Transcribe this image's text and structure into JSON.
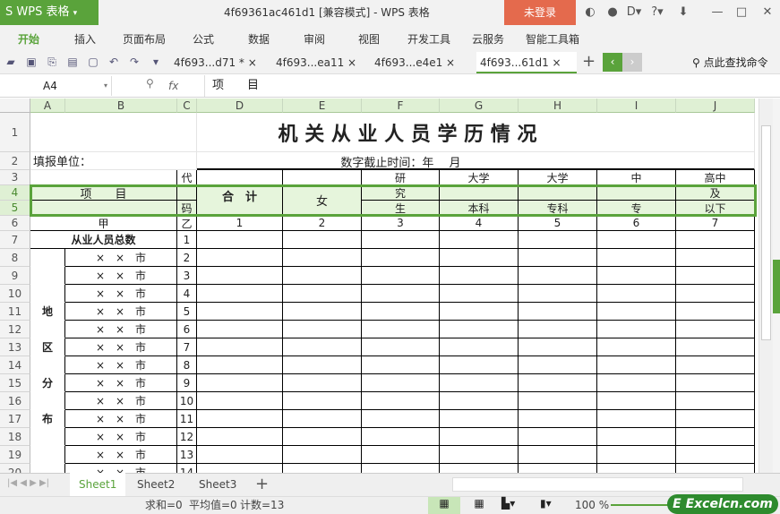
{
  "app": {
    "logo": "S WPS 表格",
    "logo_arrow": "▾",
    "title": "4f69361ac461d1 [兼容模式] - WPS 表格",
    "login": "未登录",
    "accent": "#5aa33b"
  },
  "window_buttons": [
    "◐",
    "●",
    "D▾",
    "?▾",
    "⬇",
    "—",
    "□",
    "✕"
  ],
  "menu": [
    "开始",
    "插入",
    "页面布局",
    "公式",
    "数据",
    "审阅",
    "视图",
    "开发工具",
    "云服务",
    "智能工具箱"
  ],
  "toolbar_icons": [
    "open-icon",
    "save-icon",
    "export-pdf-icon",
    "print-icon",
    "print-preview-icon",
    "undo-icon",
    "redo-icon",
    "dropdown-icon"
  ],
  "doc_tabs": [
    {
      "label": "4f693...d71 * ×"
    },
    {
      "label": "4f693...ea11 ×"
    },
    {
      "label": "4f693...e4e1 ×"
    },
    {
      "label": "4f693...61d1 ×",
      "active": true
    }
  ],
  "search_cmd": "点此查找命令",
  "formula": {
    "cell": "A4",
    "fx": "fx",
    "value": "项　　目"
  },
  "columns": [
    "A",
    "B",
    "C",
    "D",
    "E",
    "F",
    "G",
    "H",
    "I",
    "J"
  ],
  "rows": [
    "1",
    "2",
    "3",
    "4",
    "5",
    "6",
    "7",
    "8",
    "9",
    "10",
    "11",
    "12",
    "13",
    "14",
    "15",
    "16",
    "17",
    "18",
    "19",
    "20"
  ],
  "cells": {
    "title": "机 关 从 业 人 员 学 历 情 况",
    "A2": "填报单位：",
    "E2": "数字截止时间：年　 月",
    "C3": "代",
    "F3": "研",
    "G3": "大学",
    "H3": "大学",
    "I3": "中",
    "J3": "高中",
    "A4": "项　　目",
    "D4": "合　计",
    "E4": "女",
    "F4": "究",
    "J4": "及",
    "C5": "码",
    "F5": "生",
    "G5": "本科",
    "H5": "专科",
    "I5": "专",
    "J5": "以下",
    "A6": "甲",
    "C6": "乙",
    "D6": "1",
    "E6": "2",
    "F6": "3",
    "G6": "4",
    "H6": "5",
    "I6": "6",
    "J6": "7",
    "A7": "从业人员总数",
    "C7": "1",
    "city": "×　×　市",
    "codes": [
      "2",
      "3",
      "4",
      "5",
      "6",
      "7",
      "8",
      "9",
      "10",
      "11",
      "12",
      "13",
      "14"
    ],
    "A11": "地",
    "A13": "区",
    "A15": "分",
    "A17": "布"
  },
  "sheets": [
    {
      "label": "Sheet1",
      "active": true
    },
    {
      "label": "Sheet2"
    },
    {
      "label": "Sheet3"
    }
  ],
  "add_sheet": "+",
  "status": {
    "sum": "求和=0",
    "avg": "平均值=0",
    "count": "计数=13",
    "zoom": "100 %"
  },
  "brand": "Excelcn.com"
}
